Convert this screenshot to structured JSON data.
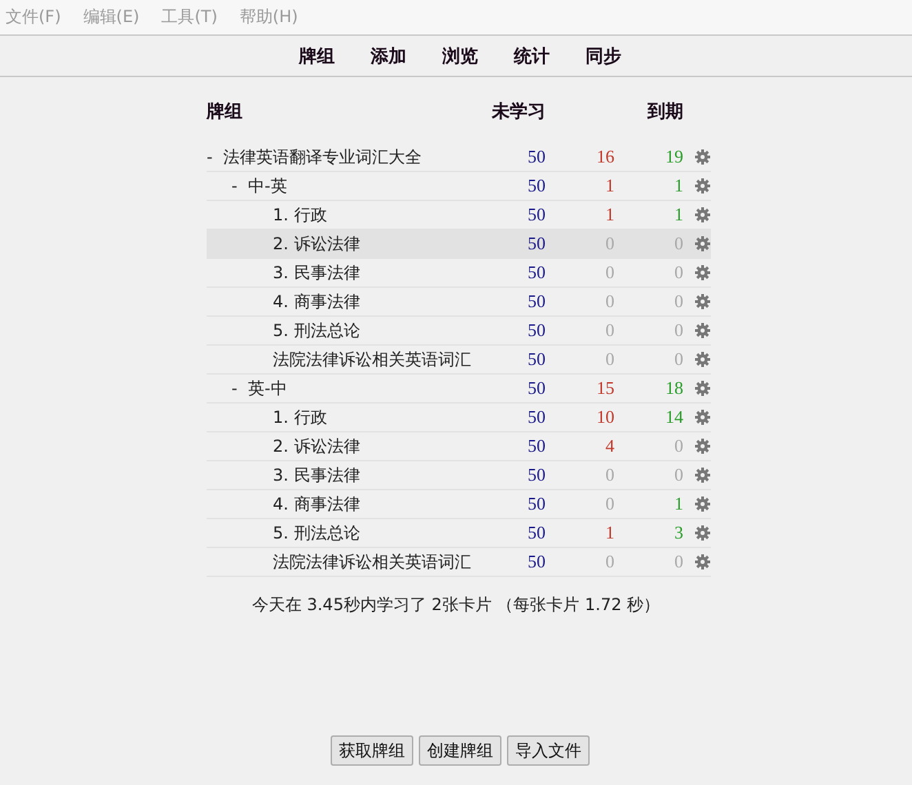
{
  "menu": [
    "文件(F)",
    "编辑(E)",
    "工具(T)",
    "帮助(H)"
  ],
  "toolbar": [
    "牌组",
    "添加",
    "浏览",
    "统计",
    "同步"
  ],
  "table": {
    "columns": [
      "牌组",
      "未学习",
      "到期"
    ],
    "decks": [
      {
        "toggle": "-",
        "name": "法律英语翻译专业词汇大全",
        "selected": false,
        "new": "50",
        "learn": {
          "text": "16",
          "muted": false
        },
        "due": {
          "text": "19",
          "muted": false
        },
        "children": [
          {
            "toggle": "-",
            "name": "中-英",
            "selected": false,
            "new": "50",
            "learn": {
              "text": "1",
              "muted": false
            },
            "due": {
              "text": "1",
              "muted": false
            },
            "children": [
              {
                "name": "1. 行政",
                "selected": false,
                "new": "50",
                "learn": {
                  "text": "1",
                  "muted": false
                },
                "due": {
                  "text": "1",
                  "muted": false
                }
              },
              {
                "name": "2. 诉讼法律",
                "selected": true,
                "new": "50",
                "learn": {
                  "text": "0",
                  "muted": true
                },
                "due": {
                  "text": "0",
                  "muted": true
                }
              },
              {
                "name": "3. 民事法律",
                "selected": false,
                "new": "50",
                "learn": {
                  "text": "0",
                  "muted": true
                },
                "due": {
                  "text": "0",
                  "muted": true
                }
              },
              {
                "name": "4. 商事法律",
                "selected": false,
                "new": "50",
                "learn": {
                  "text": "0",
                  "muted": true
                },
                "due": {
                  "text": "0",
                  "muted": true
                }
              },
              {
                "name": "5. 刑法总论",
                "selected": false,
                "new": "50",
                "learn": {
                  "text": "0",
                  "muted": true
                },
                "due": {
                  "text": "0",
                  "muted": true
                }
              },
              {
                "name": "法院法律诉讼相关英语词汇",
                "selected": false,
                "new": "50",
                "learn": {
                  "text": "0",
                  "muted": true
                },
                "due": {
                  "text": "0",
                  "muted": true
                }
              }
            ]
          },
          {
            "toggle": "-",
            "name": "英-中",
            "selected": false,
            "new": "50",
            "learn": {
              "text": "15",
              "muted": false
            },
            "due": {
              "text": "18",
              "muted": false
            },
            "children": [
              {
                "name": "1. 行政",
                "selected": false,
                "new": "50",
                "learn": {
                  "text": "10",
                  "muted": false
                },
                "due": {
                  "text": "14",
                  "muted": false
                }
              },
              {
                "name": "2. 诉讼法律",
                "selected": false,
                "new": "50",
                "learn": {
                  "text": "4",
                  "muted": false
                },
                "due": {
                  "text": "0",
                  "muted": true
                }
              },
              {
                "name": "3. 民事法律",
                "selected": false,
                "new": "50",
                "learn": {
                  "text": "0",
                  "muted": true
                },
                "due": {
                  "text": "0",
                  "muted": true
                }
              },
              {
                "name": "4. 商事法律",
                "selected": false,
                "new": "50",
                "learn": {
                  "text": "0",
                  "muted": true
                },
                "due": {
                  "text": "1",
                  "muted": false
                }
              },
              {
                "name": "5. 刑法总论",
                "selected": false,
                "new": "50",
                "learn": {
                  "text": "1",
                  "muted": false
                },
                "due": {
                  "text": "3",
                  "muted": false
                }
              },
              {
                "name": "法院法律诉讼相关英语词汇",
                "selected": false,
                "new": "50",
                "learn": {
                  "text": "0",
                  "muted": true
                },
                "due": {
                  "text": "0",
                  "muted": true
                }
              }
            ]
          }
        ]
      }
    ]
  },
  "summary": "今天在 3.45秒内学习了 2张卡片 （每张卡片 1.72 秒）",
  "buttons": [
    "获取牌组",
    "创建牌组",
    "导入文件"
  ]
}
